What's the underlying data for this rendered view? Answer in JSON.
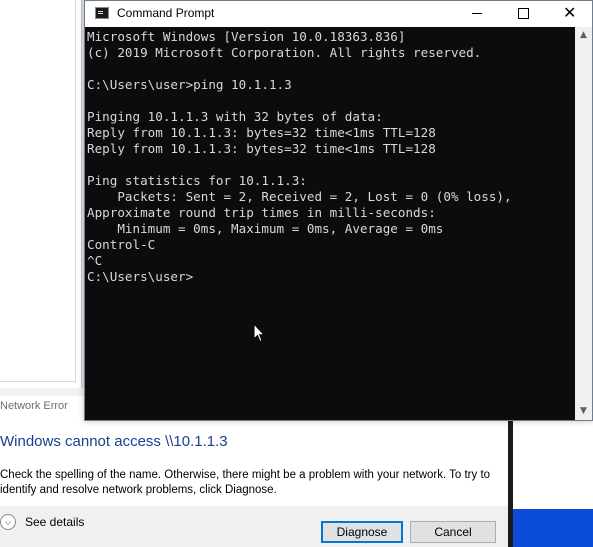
{
  "cmd_window": {
    "title": "Command Prompt",
    "minimize_glyph": "",
    "close_glyph": "✕",
    "console_lines": [
      "Microsoft Windows [Version 10.0.18363.836]",
      "(c) 2019 Microsoft Corporation. All rights reserved.",
      "",
      "C:\\Users\\user>ping 10.1.1.3",
      "",
      "Pinging 10.1.1.3 with 32 bytes of data:",
      "Reply from 10.1.1.3: bytes=32 time<1ms TTL=128",
      "Reply from 10.1.1.3: bytes=32 time<1ms TTL=128",
      "",
      "Ping statistics for 10.1.1.3:",
      "    Packets: Sent = 2, Received = 2, Lost = 0 (0% loss),",
      "Approximate round trip times in milli-seconds:",
      "    Minimum = 0ms, Maximum = 0ms, Average = 0ms",
      "Control-C",
      "^C",
      "C:\\Users\\user>"
    ],
    "colors": {
      "console_bg": "#0c0c0c",
      "console_fg": "#d8d8d8"
    }
  },
  "network_error_dialog": {
    "caption": "Network Error",
    "heading": "Windows cannot access \\\\10.1.1.3",
    "message": "Check the spelling of the name. Otherwise, there might be a problem with your network. To try to identify and resolve network problems, click Diagnose.",
    "see_details_label": "See details",
    "diagnose_label": "Diagnose",
    "cancel_label": "Cancel",
    "colors": {
      "heading": "#1b3f8f",
      "default_button_border": "#0078d7"
    }
  },
  "icons": {
    "cmd_app": "cmd-app-icon",
    "minimize": "minimize-icon",
    "maximize": "maximize-icon",
    "close": "close-icon",
    "chevron": "chevron-down-icon",
    "cursor": "mouse-cursor-icon"
  }
}
